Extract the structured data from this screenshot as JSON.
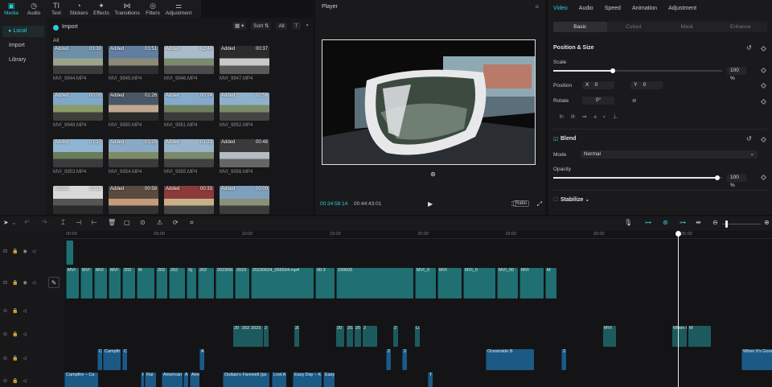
{
  "top_tabs": [
    {
      "label": "Media",
      "icon": "media-icon"
    },
    {
      "label": "Audio",
      "icon": "audio-icon"
    },
    {
      "label": "Text",
      "icon": "text-icon"
    },
    {
      "label": "Stickers",
      "icon": "stickers-icon"
    },
    {
      "label": "Effects",
      "icon": "effects-icon"
    },
    {
      "label": "Transitions",
      "icon": "transitions-icon"
    },
    {
      "label": "Filters",
      "icon": "filters-icon"
    },
    {
      "label": "Adjustment",
      "icon": "adjustment-icon"
    }
  ],
  "left_nav": [
    "Local",
    "Import",
    "Library"
  ],
  "media": {
    "import_label": "Import",
    "sort_label": "Sort",
    "all_btn": "All",
    "all_label": "All",
    "badge": "Added",
    "items": [
      {
        "name": "MVI_9944.MP4",
        "dur": "03:30"
      },
      {
        "name": "MVI_9945.MP4",
        "dur": "03:51"
      },
      {
        "name": "MVI_9946.MP4",
        "dur": "02:48"
      },
      {
        "name": "MVI_9947.MP4",
        "dur": "00:37"
      },
      {
        "name": "MVI_9948.MP4",
        "dur": "00:00"
      },
      {
        "name": "MVI_9950.MP4",
        "dur": "01:26"
      },
      {
        "name": "MVI_9951.MP4",
        "dur": "00:24"
      },
      {
        "name": "MVI_9952.MP4",
        "dur": "00:56"
      },
      {
        "name": "MVI_9953.MP4",
        "dur": "01:17"
      },
      {
        "name": "MVI_9954.MP4",
        "dur": "01:29"
      },
      {
        "name": "MVI_9955.MP4",
        "dur": "01:21"
      },
      {
        "name": "MVI_9956.MP4",
        "dur": "00:48"
      },
      {
        "name": "",
        "dur": "00:13"
      },
      {
        "name": "",
        "dur": "00:58"
      },
      {
        "name": "",
        "dur": "00:33"
      },
      {
        "name": "",
        "dur": "00:00"
      }
    ]
  },
  "player": {
    "title": "Player",
    "current": "00:34:58:14",
    "total": "00:44:43:01",
    "ratio": "Ratio"
  },
  "props": {
    "tabs": [
      "Video",
      "Audio",
      "Speed",
      "Animation",
      "Adjustment"
    ],
    "subtabs": [
      "Basic",
      "Cutout",
      "Mask",
      "Enhance"
    ],
    "position_size": "Position & Size",
    "scale_label": "Scale",
    "scale_value": "100 %",
    "scale": 1.0,
    "position_label": "Position",
    "x_label": "X",
    "x_value": "0",
    "y_label": "Y",
    "y_value": "0",
    "rotate_label": "Rotate",
    "rotate_value": "0°",
    "blend_label": "Blend",
    "mode_label": "Mode",
    "mode_value": "Normal",
    "opacity_label": "Opacity",
    "opacity_value": "100 %",
    "opacity": 1.0,
    "stabilize_label": "Stabilize"
  },
  "ruler": [
    "00:00",
    "05:00",
    "10:00",
    "15:00",
    "20:00",
    "25:00",
    "30:00",
    "35:00"
  ],
  "video_clips": [
    "MVI",
    "MVI",
    "MVI",
    "MVI",
    "202",
    "M",
    "202",
    "202",
    "Sj",
    "202",
    "20230603_194832_1.mp4",
    "2023",
    "20230604_055504.mp4",
    "00:3",
    "230605",
    "MVI_0",
    "MVI",
    "MVI_0",
    "MVI_00",
    "MVI",
    "M"
  ],
  "text_clips_top": [
    "20",
    "202",
    "2023",
    "2",
    "20",
    "20",
    "2023",
    "20",
    "2",
    "2",
    "Lullab",
    "MVI",
    "When It's",
    "M"
  ],
  "audio_clips_1": [
    "C",
    "Campfir",
    "C",
    "A",
    "2",
    "2",
    "Oceanside B",
    "2",
    "When It's Good"
  ],
  "audio_clips_2": [
    "Campfire – Ca",
    "F",
    "Rai",
    "American",
    "A",
    "Ame",
    "Outlaw's Farewell (ps",
    "Lost A",
    "Easy Day – K",
    "Easy",
    "T"
  ],
  "cover_label": "Cover"
}
